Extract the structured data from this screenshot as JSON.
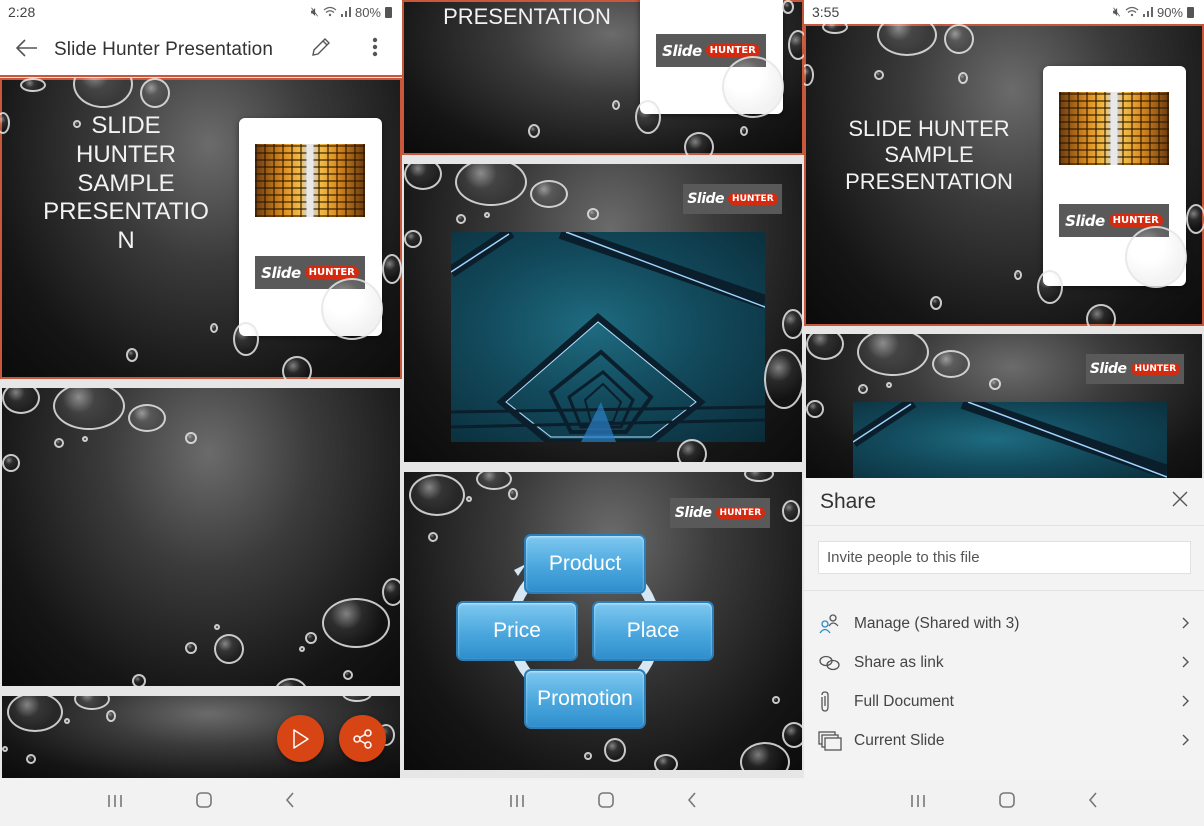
{
  "colors": {
    "accent": "#c9573b",
    "fab": "#d84515",
    "diagram_blue": "#4aa7dd",
    "logo_red": "#d42a10"
  },
  "panel1": {
    "status": {
      "time": "2:28",
      "battery": "80%"
    },
    "appbar": {
      "back_icon": "arrow-left-icon",
      "title": "Slide Hunter  Presentation",
      "edit_icon": "pencil-icon",
      "more_icon": "more-vertical-icon"
    },
    "slides": [
      {
        "title_lines": [
          "Slide",
          "Hunter",
          "Sample",
          "Presentatio",
          "n"
        ],
        "logo": {
          "slide": "Slide",
          "hunter": "HUNTER"
        },
        "selected": true
      },
      {
        "title_lines": [],
        "selected": false
      },
      {
        "title_lines": [],
        "selected": false
      }
    ],
    "fab": {
      "play_icon": "play-icon",
      "share_icon": "share-icon"
    }
  },
  "panel2": {
    "slides": [
      {
        "title": "Presentation",
        "logo": {
          "slide": "Slide",
          "hunter": "HUNTER"
        },
        "selected": true
      },
      {
        "logo": {
          "slide": "Slide",
          "hunter": "HUNTER"
        },
        "image": "bridge-photo"
      },
      {
        "logo": {
          "slide": "Slide",
          "hunter": "HUNTER"
        },
        "diagram": [
          "Product",
          "Place",
          "Promotion",
          "Price"
        ]
      }
    ]
  },
  "panel3": {
    "status": {
      "time": "3:55",
      "battery": "90%"
    },
    "slides": [
      {
        "title_lines": [
          "Slide Hunter",
          "Sample",
          "Presentation"
        ],
        "logo": {
          "slide": "Slide",
          "hunter": "HUNTER"
        },
        "selected": true
      },
      {
        "logo": {
          "slide": "Slide",
          "hunter": "HUNTER"
        },
        "image": "bridge-photo"
      }
    ],
    "share": {
      "title": "Share",
      "close_icon": "close-icon",
      "invite_placeholder": "Invite people to this file",
      "items": [
        {
          "label": "Manage (Shared with 3)",
          "icon": "people-icon"
        },
        {
          "label": "Share as link",
          "icon": "link-icon"
        },
        {
          "label": "Full Document",
          "icon": "paperclip-icon"
        },
        {
          "label": "Current Slide",
          "icon": "slides-icon"
        }
      ]
    }
  },
  "navbar": {
    "recents_icon": "recents-icon",
    "home_icon": "home-icon",
    "back_icon": "back-chevron-icon"
  }
}
